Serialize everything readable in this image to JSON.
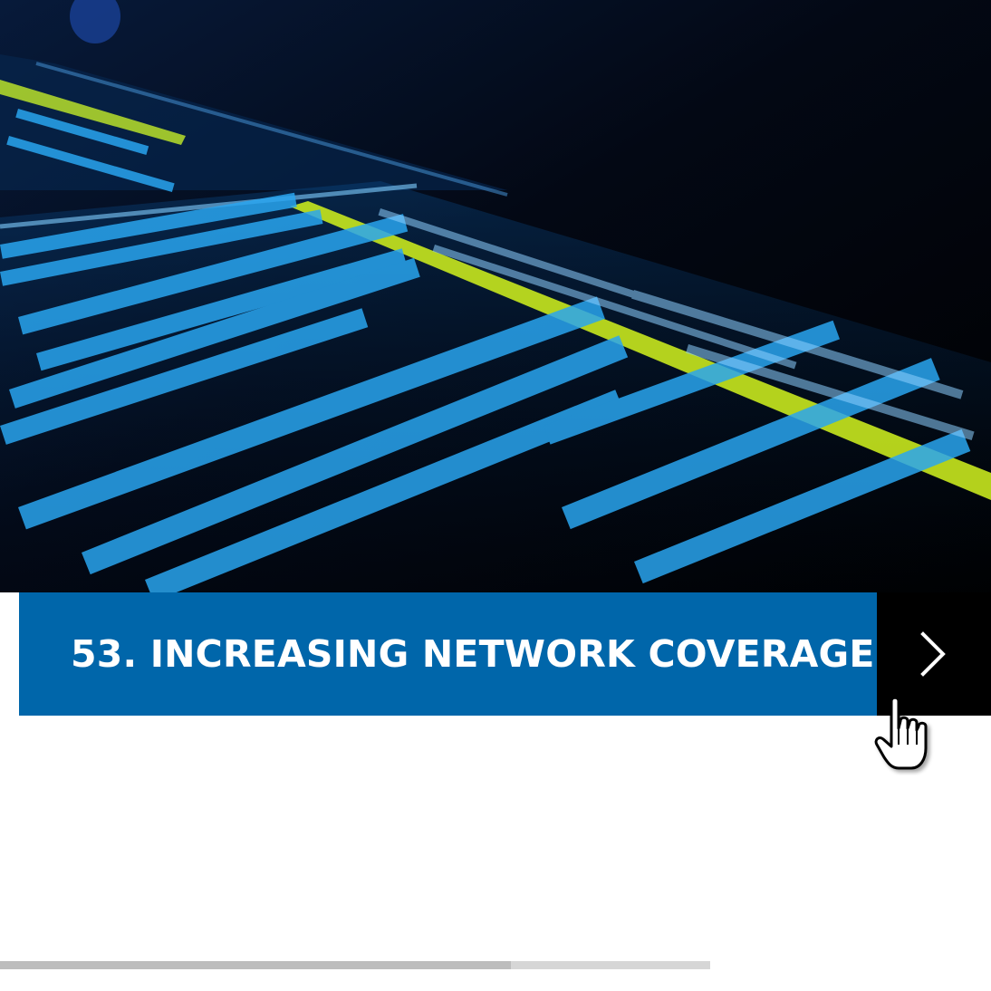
{
  "slide": {
    "title": "53. INCREASING NETWORK COVERAGE",
    "image": "network-data-screen-photo"
  },
  "navigation": {
    "next_icon": "chevron-right-icon",
    "cursor_icon": "hand-pointer-icon"
  },
  "progress": {
    "fraction": 0.72
  },
  "colors": {
    "title_bar": "#0066aa",
    "next_button": "#000000",
    "title_text": "#ffffff",
    "progress_track": "#d6d6d6"
  }
}
